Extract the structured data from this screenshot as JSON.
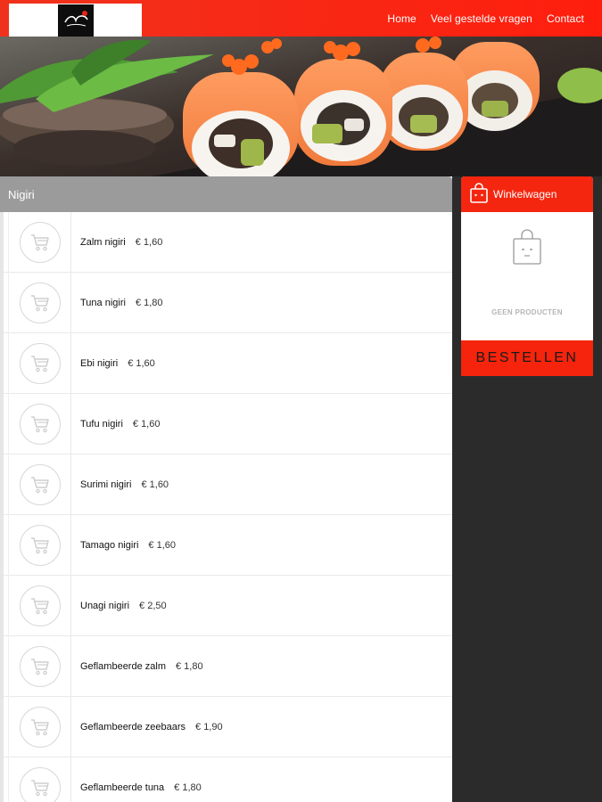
{
  "nav": {
    "logo_alt": "Sushi King",
    "links": [
      "Home",
      "Veel gestelde vragen",
      "Contact"
    ]
  },
  "colors": {
    "brand_red": "#f4260f",
    "header_gray": "#9b9b9b",
    "side_background": "#2b2b2b"
  },
  "category": {
    "title": "Nigiri"
  },
  "products": [
    {
      "name": "Zalm nigiri",
      "price": "€ 1,60"
    },
    {
      "name": "Tuna nigiri",
      "price": "€ 1,80"
    },
    {
      "name": "Ebi nigiri",
      "price": "€ 1,60"
    },
    {
      "name": "Tufu nigiri",
      "price": "€ 1,60"
    },
    {
      "name": "Surimi nigiri",
      "price": "€ 1,60"
    },
    {
      "name": "Tamago nigiri",
      "price": "€ 1,60"
    },
    {
      "name": "Unagi nigiri",
      "price": "€ 2,50"
    },
    {
      "name": "Geflambeerde zalm",
      "price": "€ 1,80"
    },
    {
      "name": "Geflambeerde zeebaars",
      "price": "€ 1,90"
    },
    {
      "name": "Geflambeerde tuna",
      "price": "€ 1,80"
    }
  ],
  "cart": {
    "title": "Winkelwagen",
    "empty_text": "GEEN PRODUCTEN",
    "order_label": "BESTELLEN"
  },
  "icons": {
    "product_add": "shopping-cart-icon",
    "cart_header": "shopping-bag-icon",
    "cart_empty": "empty-bag-icon"
  }
}
